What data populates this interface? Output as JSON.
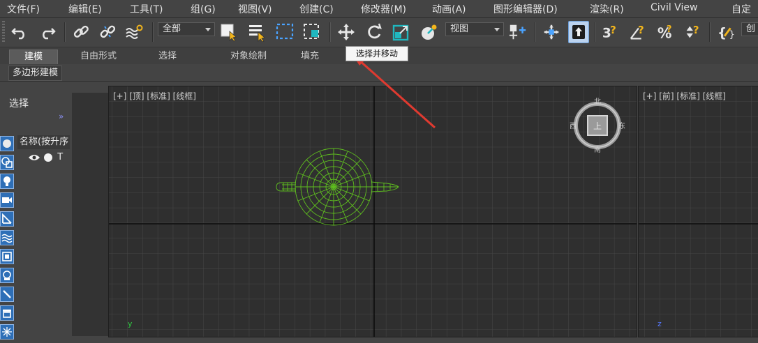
{
  "menu": [
    "文件(F)",
    "编辑(E)",
    "工具(T)",
    "组(G)",
    "视图(V)",
    "创建(C)",
    "修改器(M)",
    "动画(A)",
    "图形编辑器(D)",
    "渲染(R)",
    "Civil View",
    "自定"
  ],
  "toolbar": {
    "selection_filter": "全部",
    "coord_system": "视图",
    "create_label": "创",
    "active_tool": "move-icon",
    "icons": [
      "undo-icon",
      "redo-icon",
      "link-icon",
      "unlink-icon",
      "bind-space-warp-icon",
      "select-object-icon",
      "select-by-name-icon",
      "rectangular-selection-icon",
      "window-crossing-icon",
      "move-icon",
      "rotate-icon",
      "scale-icon",
      "placement-icon",
      "use-pivot-icon",
      "manipulate-icon",
      "keyboard-shortcut-icon",
      "snap-3d-icon",
      "angle-snap-icon",
      "percent-snap-icon",
      "spinner-snap-icon",
      "edit-named-sets-icon"
    ]
  },
  "ribbon": {
    "tabs": [
      "建模",
      "自由形式",
      "选择",
      "对象绘制",
      "填充"
    ],
    "active_tab": "建模",
    "sub_label": "多边形建模"
  },
  "tooltip": "选择并移动",
  "scene_explorer": {
    "title": "选择",
    "column_header": "名称(按升序",
    "row_label": "T",
    "side_icons": [
      "sphere-icon",
      "geometry-icon",
      "light-icon",
      "camera-icon",
      "helper-icon",
      "space-warp-icon",
      "group-icon",
      "xref-icon",
      "bone-icon",
      "container-icon",
      "particle-icon"
    ]
  },
  "viewports": {
    "top": {
      "label": "[+] [顶] [标准] [线框]",
      "axis": "y"
    },
    "front": {
      "label": "[+] [前] [标准] [线框]",
      "axis": "z"
    },
    "viewcube": {
      "north": "北",
      "south": "南",
      "east": "东",
      "west": "西",
      "face": "上"
    }
  },
  "colors": {
    "wireframe": "#5fbf1f",
    "annotation_arrow": "#e03a30",
    "active_tool_bg": "#bcd3ef"
  }
}
